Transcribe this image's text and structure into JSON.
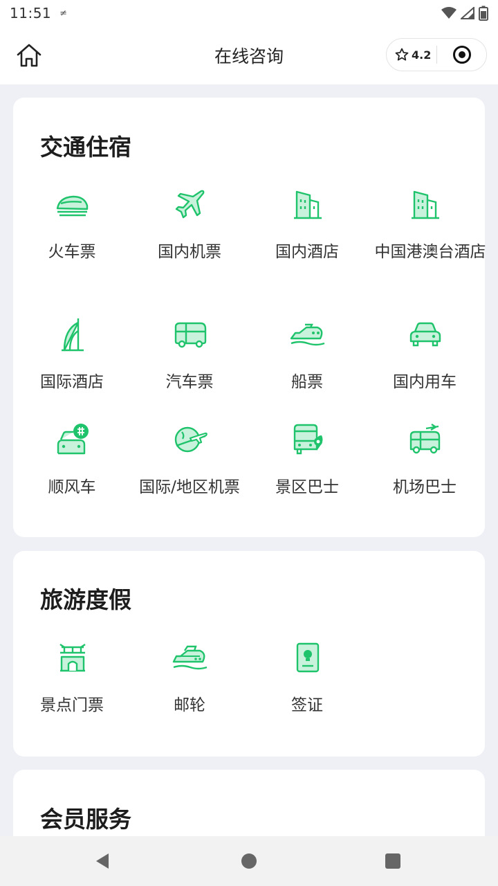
{
  "status_bar": {
    "time": "11:51",
    "indicator": "≠"
  },
  "header": {
    "title": "在线咨询",
    "rating": "4.2"
  },
  "sections": [
    {
      "title": "交通住宿",
      "items": [
        {
          "label": "火车票",
          "icon": "train-icon"
        },
        {
          "label": "国内机票",
          "icon": "plane-icon"
        },
        {
          "label": "国内酒店",
          "icon": "hotel-icon"
        },
        {
          "label": "中国港澳台酒店",
          "icon": "hotel-icon"
        },
        {
          "label": "国际酒店",
          "icon": "sail-hotel-icon"
        },
        {
          "label": "汽车票",
          "icon": "bus-icon"
        },
        {
          "label": "船票",
          "icon": "ship-icon"
        },
        {
          "label": "国内用车",
          "icon": "car-icon"
        },
        {
          "label": "顺风车",
          "icon": "carpool-icon"
        },
        {
          "label": "国际/地区机票",
          "icon": "globe-plane-icon"
        },
        {
          "label": "景区巴士",
          "icon": "scenic-bus-icon"
        },
        {
          "label": "机场巴士",
          "icon": "airport-bus-icon"
        }
      ]
    },
    {
      "title": "旅游度假",
      "items": [
        {
          "label": "景点门票",
          "icon": "gate-icon"
        },
        {
          "label": "邮轮",
          "icon": "cruise-icon"
        },
        {
          "label": "签证",
          "icon": "visa-icon"
        }
      ]
    },
    {
      "title": "会员服务"
    }
  ],
  "colors": {
    "accent": "#1fc36b",
    "accent_light": "#c9f2dc",
    "background": "#eef0f6"
  }
}
